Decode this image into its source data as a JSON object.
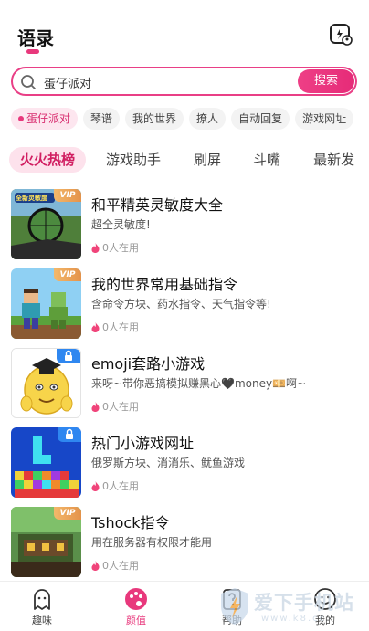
{
  "header": {
    "title": "语录"
  },
  "search": {
    "value": "蛋仔派对",
    "button_label": "搜索"
  },
  "quick_tags": [
    {
      "label": "蛋仔派对",
      "active": true
    },
    {
      "label": "琴谱",
      "active": false
    },
    {
      "label": "我的世界",
      "active": false
    },
    {
      "label": "撩人",
      "active": false
    },
    {
      "label": "自动回复",
      "active": false
    },
    {
      "label": "游戏网址",
      "active": false
    }
  ],
  "categories": [
    {
      "label": "火火热榜",
      "active": true
    },
    {
      "label": "游戏助手",
      "active": false
    },
    {
      "label": "刷屏",
      "active": false
    },
    {
      "label": "斗嘴",
      "active": false
    },
    {
      "label": "最新发",
      "active": false
    }
  ],
  "items": [
    {
      "title": "和平精英灵敏度大全",
      "desc": "超全灵敏度!",
      "users": "0人在用",
      "badge": "VIP",
      "thumb_text": "全新灵敏度"
    },
    {
      "title": "我的世界常用基础指令",
      "desc": "含命令方块、药水指令、天气指令等!",
      "users": "0人在用",
      "badge": "VIP"
    },
    {
      "title": "emoji套路小游戏",
      "desc": "来呀~带你恶搞模拟赚黑心🖤money💴啊~",
      "users": "0人在用",
      "badge": "lock"
    },
    {
      "title": "热门小游戏网址",
      "desc": "俄罗斯方块、消消乐、鱿鱼游戏",
      "users": "0人在用",
      "badge": "lock"
    },
    {
      "title": "Tshock指令",
      "desc": "用在服务器有权限才能用",
      "users": "0人在用",
      "badge": "VIP"
    }
  ],
  "bottom_nav": [
    {
      "label": "趣味",
      "icon": "ghost-icon",
      "active": false
    },
    {
      "label": "颜值",
      "icon": "palette-icon",
      "active": true
    },
    {
      "label": "帮助",
      "icon": "help-icon",
      "active": false
    },
    {
      "label": "我的",
      "icon": "smile-icon",
      "active": false
    }
  ],
  "watermark": {
    "text": "爱下手机站",
    "url": "www.k8.cc"
  },
  "colors": {
    "accent": "#e8387c",
    "vip": "#e9a25a",
    "lock": "#2f87f0"
  }
}
